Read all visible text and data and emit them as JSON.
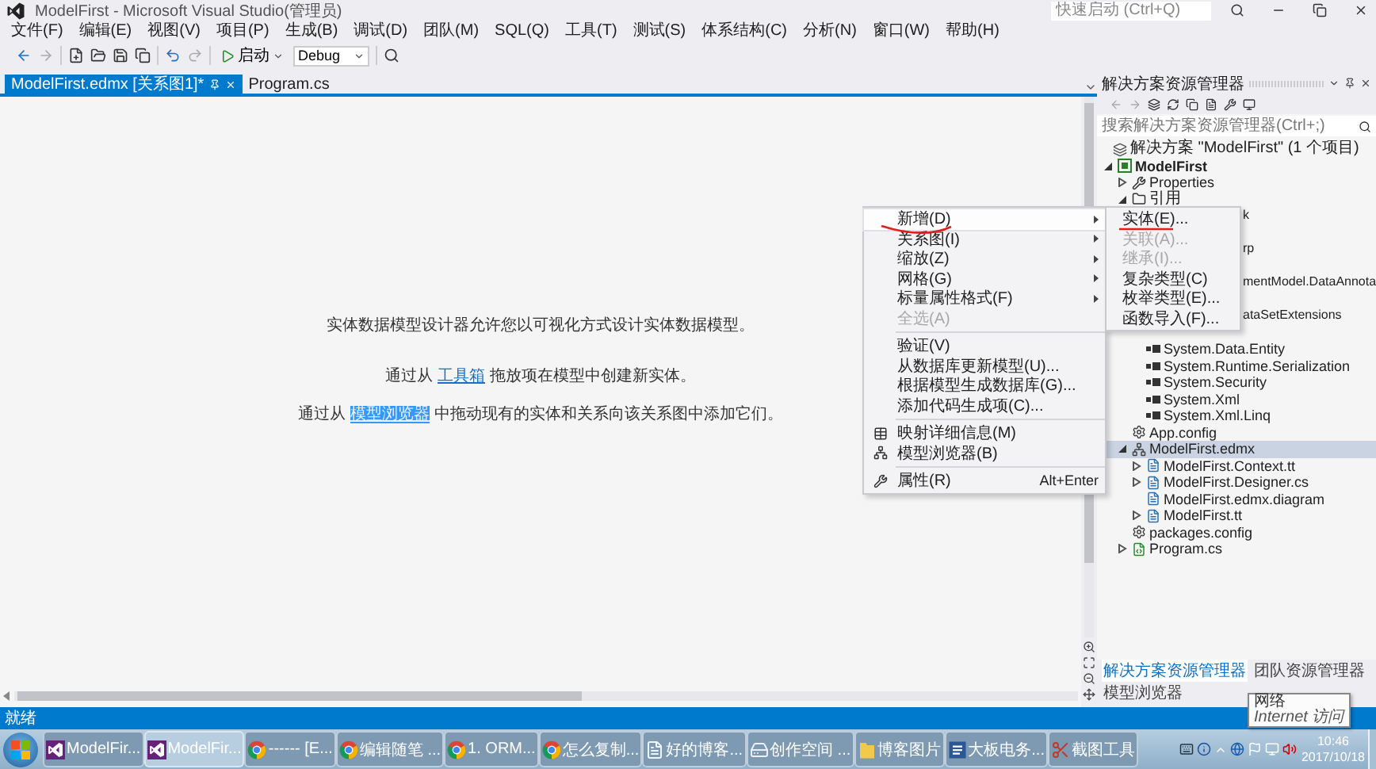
{
  "window": {
    "title": "ModelFirst - Microsoft Visual Studio(管理员)",
    "quick_launch": {
      "placeholder": "快速启动 (Ctrl+Q)"
    }
  },
  "menu": [
    "文件(F)",
    "编辑(E)",
    "视图(V)",
    "项目(P)",
    "生成(B)",
    "调试(D)",
    "团队(M)",
    "SQL(Q)",
    "工具(T)",
    "测试(S)",
    "体系结构(C)",
    "分析(N)",
    "窗口(W)",
    "帮助(H)"
  ],
  "toolbar": {
    "start_label": "启动",
    "configuration": "Debug"
  },
  "tabs": [
    {
      "label": "ModelFirst.edmx [关系图1]*",
      "selected": true
    },
    {
      "label": "Program.cs",
      "selected": false
    }
  ],
  "designer": {
    "intro": "实体数据模型设计器允许您以可视化方式设计实体数据模型。",
    "hints": [
      {
        "before": "通过从 ",
        "link": "工具箱",
        "after": " 拖放项在模型中创建新实体。",
        "selected": false
      },
      {
        "before": "通过从 ",
        "link": "模型浏览器",
        "after": " 中拖动现有的实体和关系向该关系图中添加它们。",
        "selected": true
      }
    ]
  },
  "context_menu": {
    "groups": [
      [
        {
          "label": "新增(D)",
          "kind": "submenu",
          "selected": true,
          "disabled": false
        },
        {
          "label": "关系图(I)",
          "kind": "submenu",
          "selected": false,
          "disabled": false
        },
        {
          "label": "缩放(Z)",
          "kind": "submenu",
          "selected": false,
          "disabled": false
        },
        {
          "label": "网格(G)",
          "kind": "submenu",
          "selected": false,
          "disabled": false
        },
        {
          "label": "标量属性格式(F)",
          "kind": "submenu",
          "selected": false,
          "disabled": false
        },
        {
          "label": "全选(A)",
          "kind": "command",
          "selected": false,
          "disabled": true
        }
      ],
      [
        {
          "label": "验证(V)",
          "kind": "command",
          "selected": false,
          "disabled": false
        },
        {
          "label": "从数据库更新模型(U)...",
          "kind": "command",
          "selected": false,
          "disabled": false
        },
        {
          "label": "根据模型生成数据库(G)...",
          "kind": "command",
          "selected": false,
          "disabled": false
        },
        {
          "label": "添加代码生成项(C)...",
          "kind": "command",
          "selected": false,
          "disabled": false
        }
      ],
      [
        {
          "label": "映射详细信息(M)",
          "kind": "mapping",
          "selected": false,
          "disabled": false
        },
        {
          "label": "模型浏览器(B)",
          "kind": "browser",
          "selected": false,
          "disabled": false
        }
      ],
      [
        {
          "label": "属性(R)",
          "kind": "properties",
          "selected": false,
          "disabled": false,
          "shortcut": "Alt+Enter"
        }
      ]
    ]
  },
  "submenu": {
    "items": [
      {
        "label": "实体(E)...",
        "disabled": false
      },
      {
        "label": "关联(A)...",
        "disabled": true
      },
      {
        "label": "继承(I)...",
        "disabled": true
      },
      {
        "label": "复杂类型(C)",
        "disabled": false
      },
      {
        "label": "枚举类型(E)...",
        "disabled": false
      },
      {
        "label": "函数导入(F)...",
        "disabled": false
      }
    ]
  },
  "solution_explorer": {
    "title": "解决方案资源管理器",
    "search": {
      "placeholder": "搜索解决方案资源管理器(Ctrl+;)"
    },
    "tree": [
      {
        "label": "解决方案 \"ModelFirst\" (1 个项目)",
        "kind": "solution",
        "selected": false,
        "children": [
          {
            "label": "ModelFirst",
            "kind": "project",
            "expanded": true,
            "selected": false,
            "children": [
              {
                "label": "Properties",
                "kind": "properties",
                "expanded": false,
                "selected": false
              },
              {
                "label": "引用",
                "kind": "references",
                "expanded": true,
                "selected": false,
                "children": [
                  {
                    "label": "k",
                    "kind": "clipped",
                    "selected": false
                  },
                  {
                    "label": "rp",
                    "kind": "clipped",
                    "selected": false
                  },
                  {
                    "label": "mentModel.DataAnnota",
                    "kind": "clipped",
                    "selected": false
                  },
                  {
                    "label": "ataSetExtensions",
                    "kind": "clipped",
                    "selected": false
                  },
                  {
                    "label": "System.Data.Entity",
                    "kind": "reference",
                    "selected": false
                  },
                  {
                    "label": "System.Runtime.Serialization",
                    "kind": "reference",
                    "selected": false
                  },
                  {
                    "label": "System.Security",
                    "kind": "reference",
                    "selected": false
                  },
                  {
                    "label": "System.Xml",
                    "kind": "reference",
                    "selected": false
                  },
                  {
                    "label": "System.Xml.Linq",
                    "kind": "reference",
                    "selected": false
                  }
                ]
              },
              {
                "label": "App.config",
                "kind": "config",
                "selected": false
              },
              {
                "label": "ModelFirst.edmx",
                "kind": "edmx",
                "expanded": true,
                "selected": true,
                "children": [
                  {
                    "label": "ModelFirst.Context.tt",
                    "kind": "file",
                    "expanded": false,
                    "selected": false
                  },
                  {
                    "label": "ModelFirst.Designer.cs",
                    "kind": "file",
                    "expanded": false,
                    "selected": false
                  },
                  {
                    "label": "ModelFirst.edmx.diagram",
                    "kind": "file",
                    "selected": false
                  },
                  {
                    "label": "ModelFirst.tt",
                    "kind": "file",
                    "expanded": false,
                    "selected": false
                  }
                ]
              },
              {
                "label": "packages.config",
                "kind": "config",
                "selected": false
              },
              {
                "label": "Program.cs",
                "kind": "csharp",
                "expanded": false,
                "selected": false
              }
            ]
          }
        ]
      }
    ],
    "bottom_tabs": [
      {
        "label": "解决方案资源管理器",
        "selected": true
      },
      {
        "label": "团队资源管理器",
        "selected": false
      },
      {
        "label": "模型浏览器",
        "selected": false
      }
    ]
  },
  "status_bar": {
    "text": "就绪"
  },
  "tooltip": {
    "title": "网络",
    "text": "Internet 访问"
  },
  "taskbar": {
    "items": [
      {
        "label": "ModelFir...",
        "kind": "vs",
        "selected": false
      },
      {
        "label": "ModelFir...",
        "kind": "vs",
        "selected": true
      },
      {
        "label": "------ [E...",
        "kind": "chrome",
        "selected": false
      },
      {
        "label": "编辑随笔 ...",
        "kind": "chrome",
        "selected": false
      },
      {
        "label": "1. ORM...",
        "kind": "chrome",
        "selected": false
      },
      {
        "label": "怎么复制...",
        "kind": "chrome",
        "selected": false
      },
      {
        "label": "好的博客...",
        "kind": "notepad",
        "selected": false
      },
      {
        "label": "创作空间 ...",
        "kind": "drive",
        "selected": false
      },
      {
        "label": "博客图片",
        "kind": "folder",
        "selected": false
      },
      {
        "label": "大板电务...",
        "kind": "word",
        "selected": false
      },
      {
        "label": "截图工具",
        "kind": "snip",
        "selected": false
      }
    ],
    "time": "10:46",
    "date": "2017/10/18"
  }
}
